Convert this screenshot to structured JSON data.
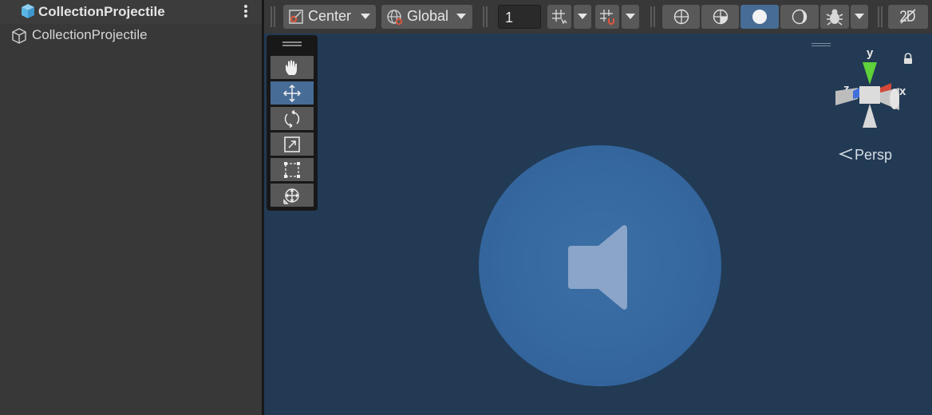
{
  "hierarchy": {
    "header_title": "CollectionProjectile",
    "items": [
      {
        "label": "CollectionProjectile"
      }
    ]
  },
  "toolbar": {
    "pivot_label": "Center",
    "space_label": "Global",
    "grid_increment": "1",
    "active_shading": "shaded"
  },
  "viewport": {
    "projection_label": "Persp",
    "active_tool": "move",
    "gizmo_axes": {
      "y": "y",
      "z": "z",
      "x": "x"
    }
  },
  "colors": {
    "accent": "#476c96",
    "viewport_bg": "#223a54",
    "sphere": "#3668a0",
    "axis_y": "#5fd13a",
    "axis_x": "#d2493a",
    "axis_z": "#3f6fd8",
    "cube_icon": "#5bb6e6"
  },
  "icons": {
    "header": "blue-cube-icon",
    "item": "gameobject-cube-icon",
    "tools": [
      "hand-icon",
      "move-icon",
      "rotate-icon",
      "scale-icon",
      "rect-icon",
      "transform-icon"
    ],
    "toolbar": [
      "pivot-icon",
      "globe-icon",
      "grid-snap-icon",
      "increment-snap-icon",
      "wireframe-icon",
      "shaded-wireframe-icon",
      "shaded-icon",
      "unlit-icon",
      "debug-bug-icon",
      "2d-toggle-icon"
    ],
    "viewport_content": "audio-source-speaker-icon"
  }
}
